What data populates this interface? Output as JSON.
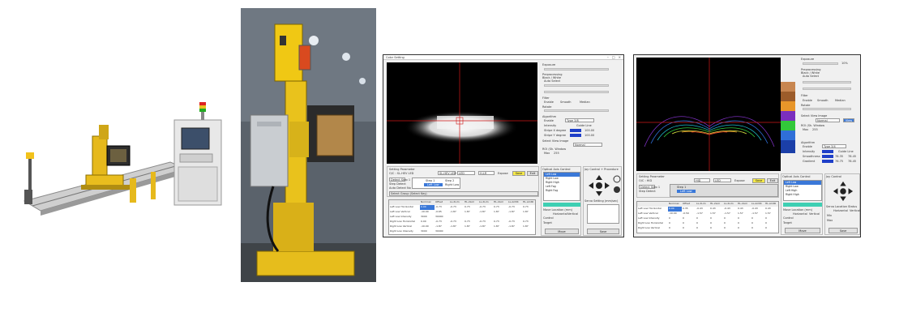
{
  "screen1": {
    "title": "Color Setting",
    "sidebar": {
      "exposure": "Exposure",
      "preprocessing": "Preprocessing",
      "black_white": "Black / White",
      "auto_select": "Auto Select",
      "filter": "Filter",
      "enable": "Enable",
      "smooth": "Smooth",
      "median": "Median",
      "rotate": "Rotate",
      "algorithm": "Algorithm",
      "type": "Type 3/8",
      "intensity": "Intensity",
      "guide_line": "Guide Line",
      "stripe_x": "Stripe X degree",
      "stripe_y": "Stripe Y degree",
      "select_view": "Select View Image",
      "view_mode": "Normal",
      "roi_window": "ROI (Sh. Window",
      "max": "Max",
      "max_val": "255",
      "v1": "100.00",
      "v2": "100.00"
    },
    "setting": {
      "label": "Setting Parameter",
      "led": "O/C : SL-HEV LED",
      "lamp": "SL-HEV LED",
      "type": "LED",
      "mode": "H-LR",
      "expose": "Expose",
      "save": "Save",
      "exit": "Exit",
      "detect_step": "Detect Step 1",
      "step_detect": "Step Detect",
      "auto_detect": "Auto Detect No",
      "list_a": "Step 1",
      "list_b": "Left Low",
      "list_c": "Step 2",
      "list_d": "Right Low",
      "select_group": "Select Group (Select Key)"
    },
    "table": {
      "headers": [
        "",
        "Nominal",
        "Offset",
        "LL.2Lim",
        "HL.2Lim",
        "LL.2Lim",
        "HL.2Lim",
        "LL.AmtR",
        "HL.AmtR"
      ],
      "rows": [
        [
          "Left Low Horizontal",
          "0.00",
          "-0.73",
          "-0.73",
          "0.73",
          "-0.73",
          "0.73",
          "-0.73",
          "0.73"
        ],
        [
          "Left Low Vertical",
          "-10.00",
          "-0.65",
          "-1.87",
          "1.87",
          "-1.87",
          "1.87",
          "-1.87",
          "1.87"
        ],
        [
          "Left Low Intensity",
          "3000",
          "30000",
          "",
          "",
          "",
          "",
          "",
          ""
        ],
        [
          "Right Low Horizontal",
          "0.00",
          "-0.73",
          "-0.73",
          "0.73",
          "-0.73",
          "0.73",
          "-0.73",
          "0.73"
        ],
        [
          "Right Low Vertical",
          "-10.00",
          "-1.87",
          "-1.87",
          "1.87",
          "-1.87",
          "1.87",
          "-1.87",
          "1.87"
        ],
        [
          "Right Low Intensity",
          "3000",
          "30000",
          "",
          "",
          "",
          "",
          "",
          ""
        ]
      ]
    },
    "optical": {
      "label": "Optical Axis Control",
      "items": [
        "Left Low",
        "Right Low",
        "Right High",
        "Left Fog",
        "Right Fog"
      ],
      "move_location": "Move Location (mm)",
      "horizontal": "Horizontal",
      "vertical": "Vertical",
      "control": "Control",
      "target": "Target",
      "move": "Move"
    },
    "joy": {
      "label": "Joy Control + Procedure",
      "servo": "Servo Setting (mm/sec)",
      "save": "Save"
    }
  },
  "screen2": {
    "sidebar": {
      "exposure": "Exposure",
      "exposure_val": "10%",
      "preprocessing": "Preprocessing",
      "black_white": "Black / White",
      "auto_select": "Auto Select",
      "filter": "Filter",
      "enable": "Enable",
      "smooth": "Smooth",
      "median": "Median",
      "rotate": "Rotate",
      "select_view": "Select View Image",
      "view_mode": "Normal",
      "view_btn": "View",
      "roi": "ROI (Sh. Window",
      "max": "Max",
      "max_val": "255",
      "algorithm": "Algorithm",
      "type": "Type 3/4",
      "intensity": "Intensity",
      "guide_line": "Guide Line",
      "smoothness": "Smoothness",
      "gradient": "Gradient",
      "v1": "78.35",
      "v2": "78.45",
      "v3": "76.75",
      "v4": "78.45"
    },
    "setting": {
      "label": "Setting Parameter",
      "led": "O/C : HID",
      "lamp": "HID",
      "type": "LED",
      "expose": "Expose",
      "save": "Save",
      "exit": "Exit",
      "detect_step": "Detect Step 1",
      "step_detect": "Step Detect",
      "list_a": "Step 1",
      "list_b": "Left Low"
    },
    "table": {
      "headers": [
        "",
        "Nominal",
        "Offset",
        "LL.2Lim",
        "HL.2Lim",
        "LL.2Lim",
        "HL.2Lim",
        "LL.AmtR",
        "HL.AmtR"
      ],
      "rows": [
        [
          "Left Low Horizontal",
          "0.00",
          "0.35",
          "-0.43",
          "0.43",
          "-0.43",
          "0.43",
          "-0.43",
          "0.43"
        ],
        [
          "Left Low Vertical",
          "-10.00",
          "-0.59",
          "-1.57",
          "1.57",
          "-1.57",
          "1.57",
          "-1.57",
          "1.57"
        ],
        [
          "Left Low Intensity",
          "0",
          "0",
          "0",
          "0",
          "0",
          "0",
          "0",
          "0"
        ],
        [
          "Right Low Horizontal",
          "0",
          "0",
          "0",
          "0",
          "0",
          "0",
          "0",
          "0"
        ],
        [
          "Right Low Vertical",
          "0",
          "0",
          "0",
          "0",
          "0",
          "0",
          "0",
          "0"
        ]
      ]
    },
    "optical": {
      "label": "Optical Axis Control",
      "items": [
        "Left Low",
        "Right Low",
        "Left High",
        "Right High"
      ],
      "move_location": "Move Location (mm)",
      "horizontal": "Horizontal",
      "vertical": "Vertical",
      "control": "Control",
      "target": "Target",
      "move": "Move"
    },
    "joy": {
      "label": "Joy Control",
      "servo": "Servo Location Status",
      "horizontal": "Horizontal",
      "vertical": "Vertical",
      "min": "Min",
      "max": "Max",
      "save": "Save"
    }
  }
}
